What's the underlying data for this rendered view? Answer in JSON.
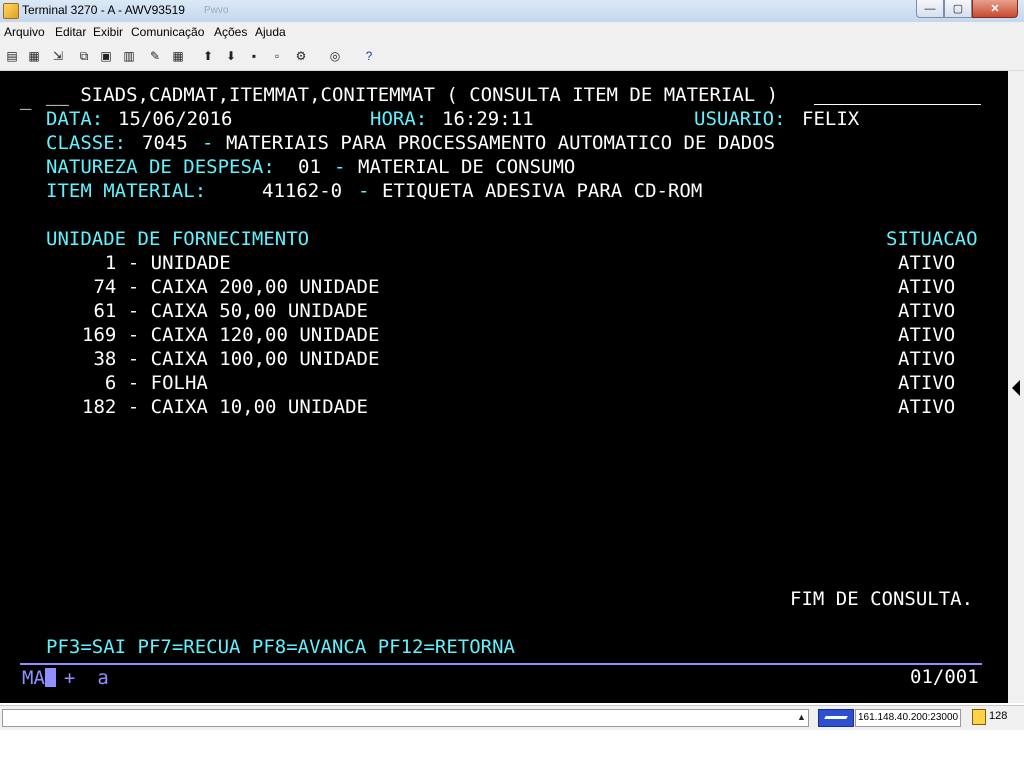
{
  "window": {
    "title": "Terminal 3270 - A - AWV93519",
    "ghost_text": "Pwvo",
    "buttons": {
      "minimize": "—",
      "maximize": "▢",
      "close": "✕"
    }
  },
  "menu": {
    "items": [
      {
        "label": "Arquivo"
      },
      {
        "label": "Editar"
      },
      {
        "label": "Exibir"
      },
      {
        "label": "Comunicação"
      },
      {
        "label": "Ações"
      },
      {
        "label": "Ajuda"
      }
    ]
  },
  "toolbar": {
    "icons": [
      "print-screen-icon",
      "print-icon",
      "import-icon",
      "copy-icon",
      "paste-icon",
      "paste-special-icon",
      "macro-icon",
      "keypad-icon",
      "send-file-icon",
      "receive-file-icon",
      "connect-icon",
      "disconnect-icon",
      "settings-icon",
      "hotspot-icon",
      "help-icon"
    ]
  },
  "terminal": {
    "header_cursor": "_",
    "header_title": "__ SIADS,CADMAT,ITEMMAT,CONITEMMAT ( CONSULTA ITEM DE MATERIAL )",
    "data_label": "DATA:",
    "data_value": "15/06/2016",
    "hora_label": "HORA:",
    "hora_value": "16:29:11",
    "usuario_label": "USUARIO:",
    "usuario_value": "FELIX",
    "classe_label": "CLASSE:",
    "classe_code": "7045",
    "classe_sep": "-",
    "classe_desc": "MATERIAIS PARA PROCESSAMENTO AUTOMATICO DE DADOS",
    "natureza_label": "NATUREZA DE DESPESA:",
    "natureza_code": "01",
    "natureza_sep": "-",
    "natureza_desc": "MATERIAL DE CONSUMO",
    "item_label": "ITEM MATERIAL:",
    "item_code": "41162-0",
    "item_sep": "-",
    "item_desc": "ETIQUETA ADESIVA PARA CD-ROM",
    "col_unidade": "UNIDADE DE FORNECIMENTO",
    "col_situacao": "SITUACAO",
    "rows": [
      {
        "unit": "  1 - UNIDADE",
        "status": "ATIVO"
      },
      {
        "unit": " 74 - CAIXA 200,00 UNIDADE",
        "status": "ATIVO"
      },
      {
        "unit": " 61 - CAIXA 50,00 UNIDADE",
        "status": "ATIVO"
      },
      {
        "unit": "169 - CAIXA 120,00 UNIDADE",
        "status": "ATIVO"
      },
      {
        "unit": " 38 - CAIXA 100,00 UNIDADE",
        "status": "ATIVO"
      },
      {
        "unit": "  6 - FOLHA",
        "status": "ATIVO"
      },
      {
        "unit": "182 - CAIXA 10,00 UNIDADE",
        "status": "ATIVO"
      }
    ],
    "end_message": "FIM DE CONSULTA.",
    "function_keys": "PF3=SAI PF7=RECUA PF8=AVANCA PF12=RETORNA",
    "oia_left": "MA",
    "oia_cursor": "A",
    "oia_plus": "+",
    "oia_a": "a",
    "oia_page": "01/001"
  },
  "statusbar": {
    "field_text": "",
    "host": "161.148.40.200:23000",
    "count": "128"
  },
  "colors": {
    "terminal_bg": "#000000",
    "label_color": "#5ff2ff",
    "value_color": "#ffffff",
    "oia_color": "#8f8fff"
  }
}
